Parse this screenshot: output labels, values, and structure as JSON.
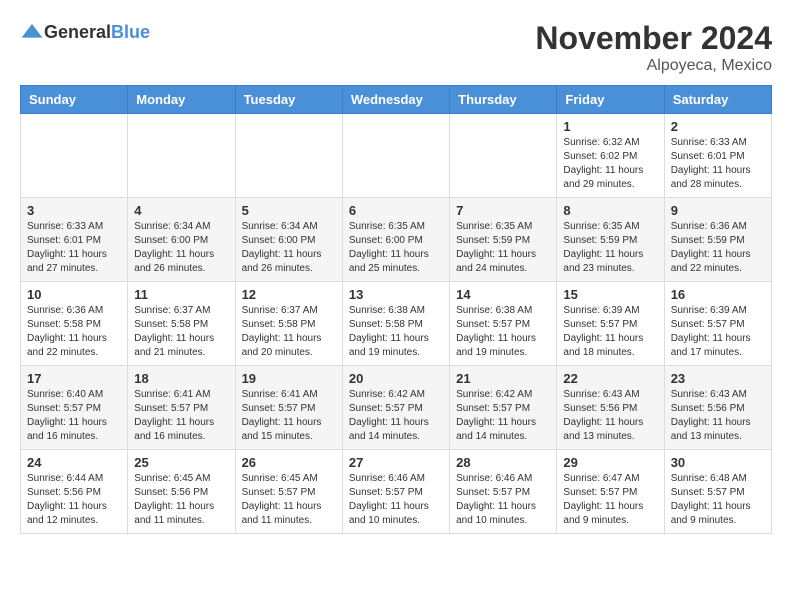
{
  "logo": {
    "text_general": "General",
    "text_blue": "Blue"
  },
  "header": {
    "month": "November 2024",
    "location": "Alpoyeca, Mexico"
  },
  "weekdays": [
    "Sunday",
    "Monday",
    "Tuesday",
    "Wednesday",
    "Thursday",
    "Friday",
    "Saturday"
  ],
  "weeks": [
    [
      {
        "day": "",
        "info": ""
      },
      {
        "day": "",
        "info": ""
      },
      {
        "day": "",
        "info": ""
      },
      {
        "day": "",
        "info": ""
      },
      {
        "day": "",
        "info": ""
      },
      {
        "day": "1",
        "info": "Sunrise: 6:32 AM\nSunset: 6:02 PM\nDaylight: 11 hours and 29 minutes."
      },
      {
        "day": "2",
        "info": "Sunrise: 6:33 AM\nSunset: 6:01 PM\nDaylight: 11 hours and 28 minutes."
      }
    ],
    [
      {
        "day": "3",
        "info": "Sunrise: 6:33 AM\nSunset: 6:01 PM\nDaylight: 11 hours and 27 minutes."
      },
      {
        "day": "4",
        "info": "Sunrise: 6:34 AM\nSunset: 6:00 PM\nDaylight: 11 hours and 26 minutes."
      },
      {
        "day": "5",
        "info": "Sunrise: 6:34 AM\nSunset: 6:00 PM\nDaylight: 11 hours and 26 minutes."
      },
      {
        "day": "6",
        "info": "Sunrise: 6:35 AM\nSunset: 6:00 PM\nDaylight: 11 hours and 25 minutes."
      },
      {
        "day": "7",
        "info": "Sunrise: 6:35 AM\nSunset: 5:59 PM\nDaylight: 11 hours and 24 minutes."
      },
      {
        "day": "8",
        "info": "Sunrise: 6:35 AM\nSunset: 5:59 PM\nDaylight: 11 hours and 23 minutes."
      },
      {
        "day": "9",
        "info": "Sunrise: 6:36 AM\nSunset: 5:59 PM\nDaylight: 11 hours and 22 minutes."
      }
    ],
    [
      {
        "day": "10",
        "info": "Sunrise: 6:36 AM\nSunset: 5:58 PM\nDaylight: 11 hours and 22 minutes."
      },
      {
        "day": "11",
        "info": "Sunrise: 6:37 AM\nSunset: 5:58 PM\nDaylight: 11 hours and 21 minutes."
      },
      {
        "day": "12",
        "info": "Sunrise: 6:37 AM\nSunset: 5:58 PM\nDaylight: 11 hours and 20 minutes."
      },
      {
        "day": "13",
        "info": "Sunrise: 6:38 AM\nSunset: 5:58 PM\nDaylight: 11 hours and 19 minutes."
      },
      {
        "day": "14",
        "info": "Sunrise: 6:38 AM\nSunset: 5:57 PM\nDaylight: 11 hours and 19 minutes."
      },
      {
        "day": "15",
        "info": "Sunrise: 6:39 AM\nSunset: 5:57 PM\nDaylight: 11 hours and 18 minutes."
      },
      {
        "day": "16",
        "info": "Sunrise: 6:39 AM\nSunset: 5:57 PM\nDaylight: 11 hours and 17 minutes."
      }
    ],
    [
      {
        "day": "17",
        "info": "Sunrise: 6:40 AM\nSunset: 5:57 PM\nDaylight: 11 hours and 16 minutes."
      },
      {
        "day": "18",
        "info": "Sunrise: 6:41 AM\nSunset: 5:57 PM\nDaylight: 11 hours and 16 minutes."
      },
      {
        "day": "19",
        "info": "Sunrise: 6:41 AM\nSunset: 5:57 PM\nDaylight: 11 hours and 15 minutes."
      },
      {
        "day": "20",
        "info": "Sunrise: 6:42 AM\nSunset: 5:57 PM\nDaylight: 11 hours and 14 minutes."
      },
      {
        "day": "21",
        "info": "Sunrise: 6:42 AM\nSunset: 5:57 PM\nDaylight: 11 hours and 14 minutes."
      },
      {
        "day": "22",
        "info": "Sunrise: 6:43 AM\nSunset: 5:56 PM\nDaylight: 11 hours and 13 minutes."
      },
      {
        "day": "23",
        "info": "Sunrise: 6:43 AM\nSunset: 5:56 PM\nDaylight: 11 hours and 13 minutes."
      }
    ],
    [
      {
        "day": "24",
        "info": "Sunrise: 6:44 AM\nSunset: 5:56 PM\nDaylight: 11 hours and 12 minutes."
      },
      {
        "day": "25",
        "info": "Sunrise: 6:45 AM\nSunset: 5:56 PM\nDaylight: 11 hours and 11 minutes."
      },
      {
        "day": "26",
        "info": "Sunrise: 6:45 AM\nSunset: 5:57 PM\nDaylight: 11 hours and 11 minutes."
      },
      {
        "day": "27",
        "info": "Sunrise: 6:46 AM\nSunset: 5:57 PM\nDaylight: 11 hours and 10 minutes."
      },
      {
        "day": "28",
        "info": "Sunrise: 6:46 AM\nSunset: 5:57 PM\nDaylight: 11 hours and 10 minutes."
      },
      {
        "day": "29",
        "info": "Sunrise: 6:47 AM\nSunset: 5:57 PM\nDaylight: 11 hours and 9 minutes."
      },
      {
        "day": "30",
        "info": "Sunrise: 6:48 AM\nSunset: 5:57 PM\nDaylight: 11 hours and 9 minutes."
      }
    ]
  ]
}
